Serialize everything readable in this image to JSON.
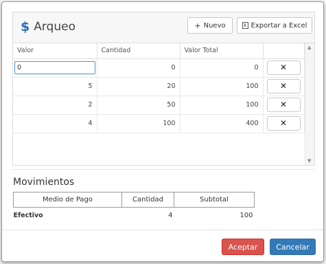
{
  "header": {
    "icon": "dollar-icon",
    "icon_glyph": "$",
    "title": "Arqueo",
    "new_button": "Nuevo",
    "new_icon_glyph": "+",
    "export_button": "Exportar a Excel",
    "export_icon_glyph": "X"
  },
  "grid": {
    "columns": [
      "Valor",
      "Cantidad",
      "Valor Total",
      ""
    ],
    "editing_value": "0",
    "delete_glyph": "✕",
    "rows": [
      {
        "valor": "0",
        "cantidad": "0",
        "total": "0"
      },
      {
        "valor": "5",
        "cantidad": "20",
        "total": "100"
      },
      {
        "valor": "2",
        "cantidad": "50",
        "total": "100"
      },
      {
        "valor": "4",
        "cantidad": "100",
        "total": "400"
      }
    ],
    "scroll_up_glyph": "▲",
    "scroll_down_glyph": "▼"
  },
  "movimientos": {
    "title": "Movimientos",
    "columns": [
      "Medio de Pago",
      "Cantidad",
      "Subtotal"
    ],
    "rows": [
      {
        "medio": "Efectivo",
        "cantidad": "4",
        "subtotal": "100"
      }
    ]
  },
  "footer": {
    "accept": "Aceptar",
    "cancel": "Cancelar"
  },
  "colors": {
    "accent": "#337ab7",
    "danger": "#d9534f",
    "dollar": "#2a6ebb"
  }
}
